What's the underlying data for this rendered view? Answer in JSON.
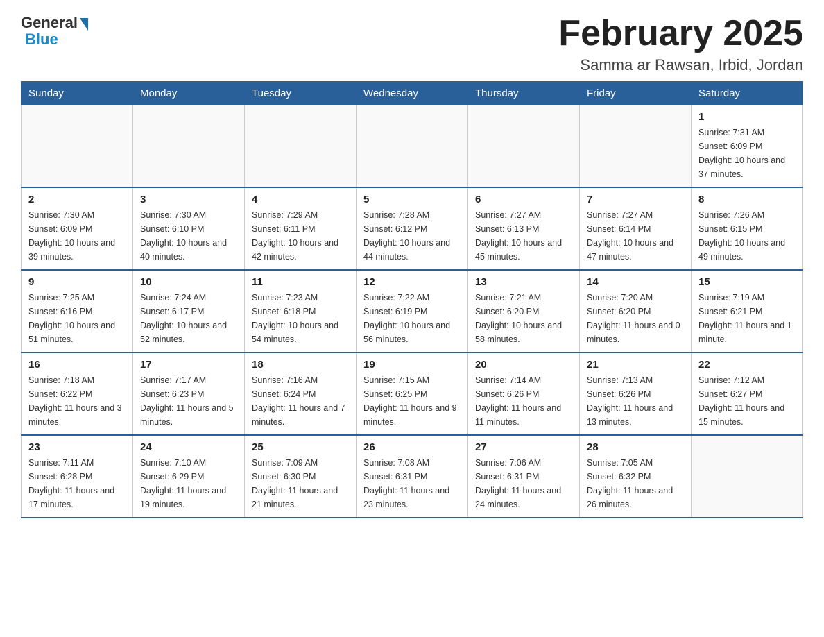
{
  "logo": {
    "general": "General",
    "blue": "Blue"
  },
  "title": "February 2025",
  "subtitle": "Samma ar Rawsan, Irbid, Jordan",
  "days_of_week": [
    "Sunday",
    "Monday",
    "Tuesday",
    "Wednesday",
    "Thursday",
    "Friday",
    "Saturday"
  ],
  "weeks": [
    [
      {
        "day": "",
        "info": ""
      },
      {
        "day": "",
        "info": ""
      },
      {
        "day": "",
        "info": ""
      },
      {
        "day": "",
        "info": ""
      },
      {
        "day": "",
        "info": ""
      },
      {
        "day": "",
        "info": ""
      },
      {
        "day": "1",
        "info": "Sunrise: 7:31 AM\nSunset: 6:09 PM\nDaylight: 10 hours and 37 minutes."
      }
    ],
    [
      {
        "day": "2",
        "info": "Sunrise: 7:30 AM\nSunset: 6:09 PM\nDaylight: 10 hours and 39 minutes."
      },
      {
        "day": "3",
        "info": "Sunrise: 7:30 AM\nSunset: 6:10 PM\nDaylight: 10 hours and 40 minutes."
      },
      {
        "day": "4",
        "info": "Sunrise: 7:29 AM\nSunset: 6:11 PM\nDaylight: 10 hours and 42 minutes."
      },
      {
        "day": "5",
        "info": "Sunrise: 7:28 AM\nSunset: 6:12 PM\nDaylight: 10 hours and 44 minutes."
      },
      {
        "day": "6",
        "info": "Sunrise: 7:27 AM\nSunset: 6:13 PM\nDaylight: 10 hours and 45 minutes."
      },
      {
        "day": "7",
        "info": "Sunrise: 7:27 AM\nSunset: 6:14 PM\nDaylight: 10 hours and 47 minutes."
      },
      {
        "day": "8",
        "info": "Sunrise: 7:26 AM\nSunset: 6:15 PM\nDaylight: 10 hours and 49 minutes."
      }
    ],
    [
      {
        "day": "9",
        "info": "Sunrise: 7:25 AM\nSunset: 6:16 PM\nDaylight: 10 hours and 51 minutes."
      },
      {
        "day": "10",
        "info": "Sunrise: 7:24 AM\nSunset: 6:17 PM\nDaylight: 10 hours and 52 minutes."
      },
      {
        "day": "11",
        "info": "Sunrise: 7:23 AM\nSunset: 6:18 PM\nDaylight: 10 hours and 54 minutes."
      },
      {
        "day": "12",
        "info": "Sunrise: 7:22 AM\nSunset: 6:19 PM\nDaylight: 10 hours and 56 minutes."
      },
      {
        "day": "13",
        "info": "Sunrise: 7:21 AM\nSunset: 6:20 PM\nDaylight: 10 hours and 58 minutes."
      },
      {
        "day": "14",
        "info": "Sunrise: 7:20 AM\nSunset: 6:20 PM\nDaylight: 11 hours and 0 minutes."
      },
      {
        "day": "15",
        "info": "Sunrise: 7:19 AM\nSunset: 6:21 PM\nDaylight: 11 hours and 1 minute."
      }
    ],
    [
      {
        "day": "16",
        "info": "Sunrise: 7:18 AM\nSunset: 6:22 PM\nDaylight: 11 hours and 3 minutes."
      },
      {
        "day": "17",
        "info": "Sunrise: 7:17 AM\nSunset: 6:23 PM\nDaylight: 11 hours and 5 minutes."
      },
      {
        "day": "18",
        "info": "Sunrise: 7:16 AM\nSunset: 6:24 PM\nDaylight: 11 hours and 7 minutes."
      },
      {
        "day": "19",
        "info": "Sunrise: 7:15 AM\nSunset: 6:25 PM\nDaylight: 11 hours and 9 minutes."
      },
      {
        "day": "20",
        "info": "Sunrise: 7:14 AM\nSunset: 6:26 PM\nDaylight: 11 hours and 11 minutes."
      },
      {
        "day": "21",
        "info": "Sunrise: 7:13 AM\nSunset: 6:26 PM\nDaylight: 11 hours and 13 minutes."
      },
      {
        "day": "22",
        "info": "Sunrise: 7:12 AM\nSunset: 6:27 PM\nDaylight: 11 hours and 15 minutes."
      }
    ],
    [
      {
        "day": "23",
        "info": "Sunrise: 7:11 AM\nSunset: 6:28 PM\nDaylight: 11 hours and 17 minutes."
      },
      {
        "day": "24",
        "info": "Sunrise: 7:10 AM\nSunset: 6:29 PM\nDaylight: 11 hours and 19 minutes."
      },
      {
        "day": "25",
        "info": "Sunrise: 7:09 AM\nSunset: 6:30 PM\nDaylight: 11 hours and 21 minutes."
      },
      {
        "day": "26",
        "info": "Sunrise: 7:08 AM\nSunset: 6:31 PM\nDaylight: 11 hours and 23 minutes."
      },
      {
        "day": "27",
        "info": "Sunrise: 7:06 AM\nSunset: 6:31 PM\nDaylight: 11 hours and 24 minutes."
      },
      {
        "day": "28",
        "info": "Sunrise: 7:05 AM\nSunset: 6:32 PM\nDaylight: 11 hours and 26 minutes."
      },
      {
        "day": "",
        "info": ""
      }
    ]
  ]
}
